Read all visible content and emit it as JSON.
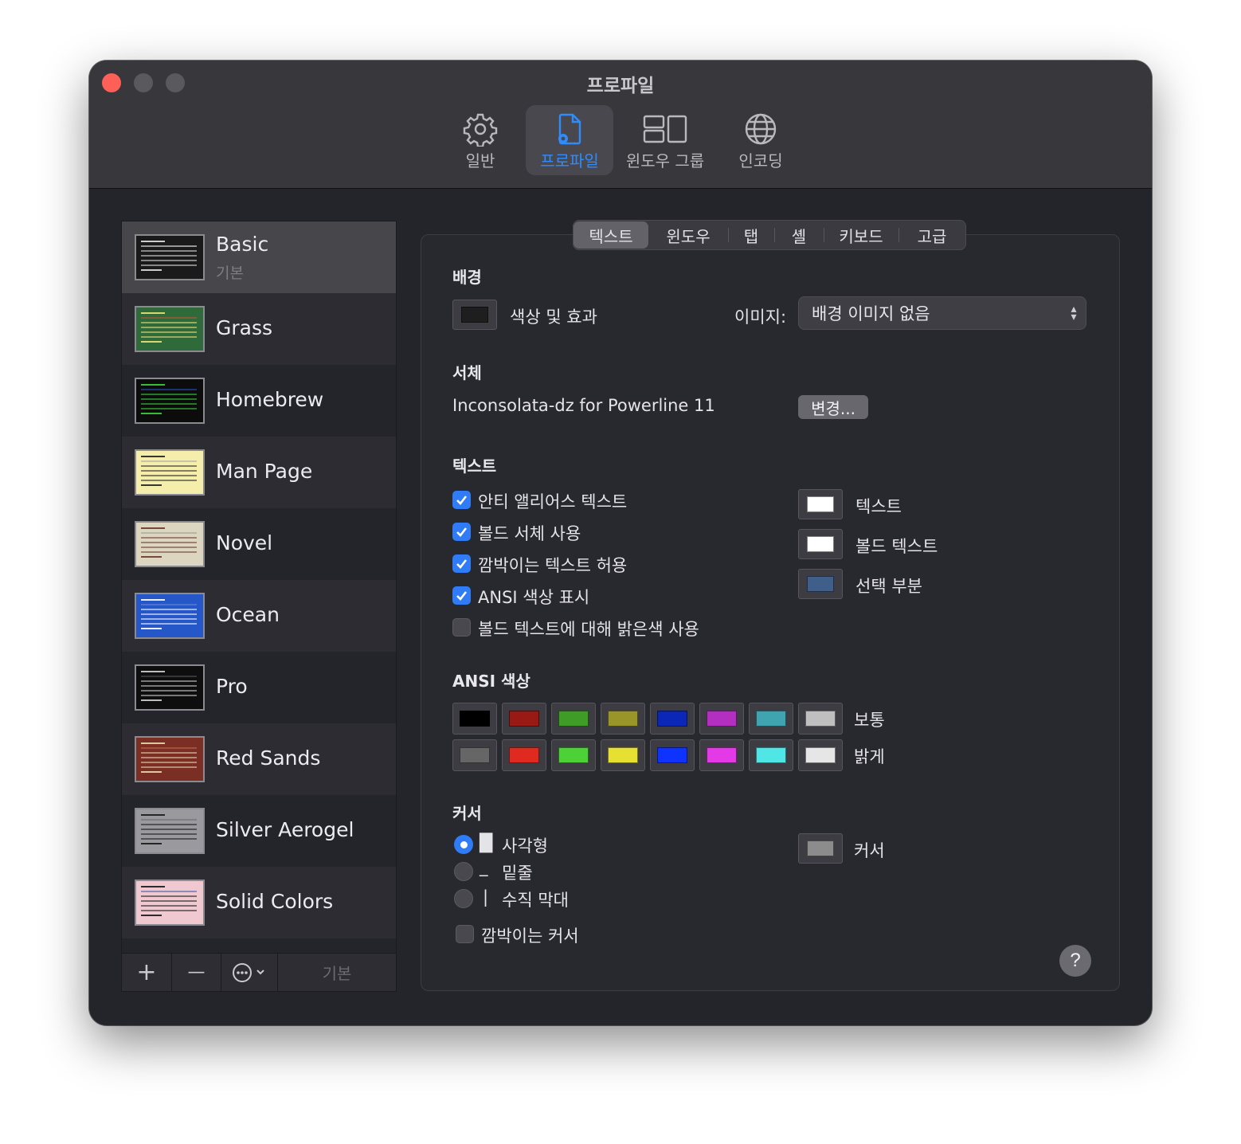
{
  "window": {
    "title": "프로파일"
  },
  "toolbar": [
    {
      "label": "일반",
      "icon": "gear-icon"
    },
    {
      "label": "프로파일",
      "icon": "profile-doc-icon"
    },
    {
      "label": "윈도우 그룹",
      "icon": "window-group-icon"
    },
    {
      "label": "인코딩",
      "icon": "globe-icon"
    }
  ],
  "profiles": [
    {
      "name": "Basic",
      "sub": "기본",
      "bg": "#1a1a1a",
      "fg": "#e0e0e0",
      "accent": "#ffffff"
    },
    {
      "name": "Grass",
      "sub": "",
      "bg": "#2f6b3a",
      "fg": "#f0e07a",
      "accent": "#c8503a"
    },
    {
      "name": "Homebrew",
      "sub": "",
      "bg": "#0c0c0c",
      "fg": "#3ad23a",
      "accent": "#2a52c8"
    },
    {
      "name": "Man Page",
      "sub": "",
      "bg": "#f5eeaa",
      "fg": "#222222",
      "accent": "#a0a0a0"
    },
    {
      "name": "Novel",
      "sub": "",
      "bg": "#dcd6c0",
      "fg": "#6a3a2a",
      "accent": "#9a9a88"
    },
    {
      "name": "Ocean",
      "sub": "",
      "bg": "#2557c8",
      "fg": "#ffffff",
      "accent": "#6a8ad8"
    },
    {
      "name": "Pro",
      "sub": "",
      "bg": "#0e0e0e",
      "fg": "#d0d0d0",
      "accent": "#5a5a5a"
    },
    {
      "name": "Red Sands",
      "sub": "",
      "bg": "#7a2e24",
      "fg": "#e8d8b0",
      "accent": "#c86a4a"
    },
    {
      "name": "Silver Aerogel",
      "sub": "",
      "bg": "#9a9a9e",
      "fg": "#1a1a1a",
      "accent": "#6a6a70"
    },
    {
      "name": "Solid Colors",
      "sub": "",
      "bg": "#f0c8d0",
      "fg": "#1a1a1a",
      "accent": "#3a5aa8"
    }
  ],
  "list_toolbar": {
    "add": "+",
    "remove": "—",
    "more_icon": "ellipsis-circle-icon",
    "default_label": "기본"
  },
  "tabs": [
    "텍스트",
    "윈도우",
    "탭",
    "셸",
    "키보드",
    "고급"
  ],
  "selected_tab": "텍스트",
  "background": {
    "heading": "배경",
    "color_effects_label": "색상 및 효과",
    "color_swatch": "#1e1e1e",
    "image_label": "이미지:",
    "image_value": "배경 이미지 없음"
  },
  "font": {
    "heading": "서체",
    "value": "Inconsolata-dz for Powerline 11",
    "change_button": "변경..."
  },
  "text": {
    "heading": "텍스트",
    "checkboxes": [
      {
        "label": "안티 앨리어스 텍스트",
        "checked": true
      },
      {
        "label": "볼드 서체 사용",
        "checked": true
      },
      {
        "label": "깜박이는 텍스트 허용",
        "checked": true
      },
      {
        "label": "ANSI 색상 표시",
        "checked": true
      },
      {
        "label": "볼드 텍스트에 대해 밝은색 사용",
        "checked": false
      }
    ],
    "colors": [
      {
        "label": "텍스트",
        "color": "#ffffff"
      },
      {
        "label": "볼드 텍스트",
        "color": "#ffffff"
      },
      {
        "label": "선택 부분",
        "color": "#3f5f8a"
      }
    ]
  },
  "ansi": {
    "heading": "ANSI 색상",
    "normal_label": "보통",
    "bright_label": "밝게",
    "normal": [
      "#000000",
      "#991a14",
      "#3f9c27",
      "#999528",
      "#0a27b8",
      "#b22fbf",
      "#3fa3b0",
      "#bfbfbf"
    ],
    "bright": [
      "#666666",
      "#e02a1f",
      "#4cd236",
      "#e6e033",
      "#0f33ff",
      "#e339e6",
      "#51e6e6",
      "#e6e6e6"
    ]
  },
  "cursor": {
    "heading": "커서",
    "options": [
      {
        "glyph": "█",
        "label": "사각형",
        "selected": true
      },
      {
        "glyph": "_",
        "label": "밑줄",
        "selected": false
      },
      {
        "glyph": "|",
        "label": "수직 막대",
        "selected": false
      }
    ],
    "blink_label": "깜박이는 커서",
    "blink_checked": false,
    "color_label": "커서",
    "color": "#8c8c8c"
  },
  "help_label": "?"
}
